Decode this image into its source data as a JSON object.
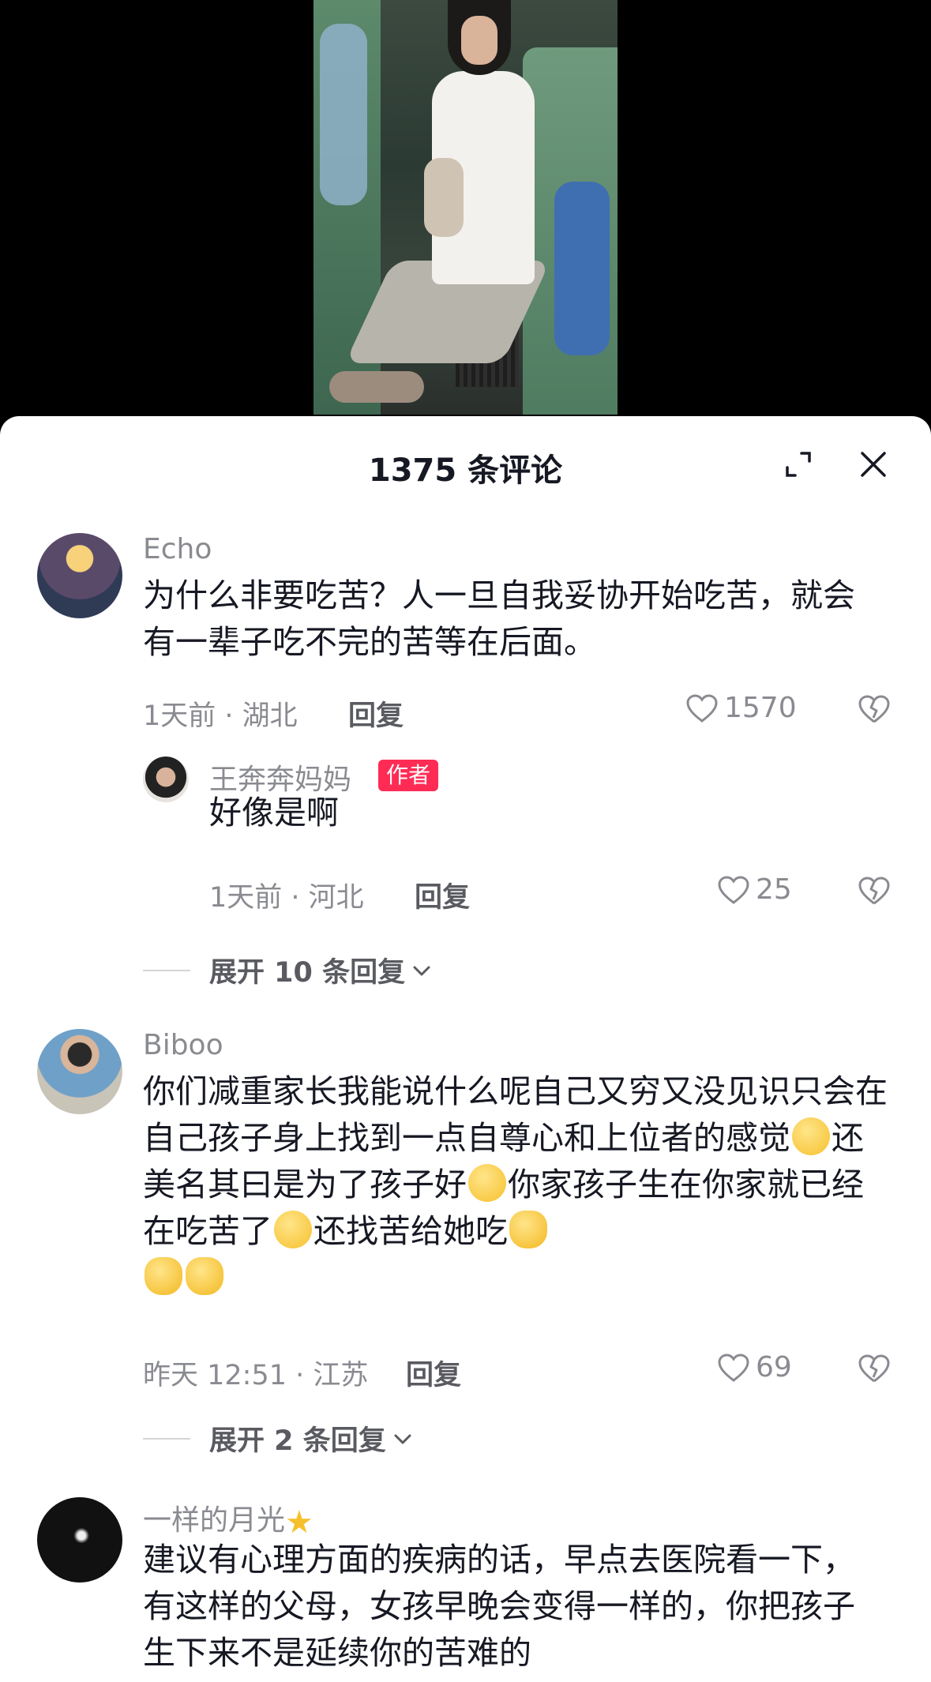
{
  "sheet": {
    "title": "1375 条评论",
    "expand_icon": "expand-icon",
    "close_icon": "close-icon"
  },
  "colors": {
    "accent": "#fe2c55",
    "text_primary": "#161823",
    "text_secondary": "#8a8b91"
  },
  "comments": [
    {
      "username": "Echo",
      "text": "为什么非要吃苦？人一旦自我妥协开始吃苦，就会有一辈子吃不完的苦等在后面。",
      "meta": "1天前 · 湖北",
      "reply_label": "回复",
      "likes": "1570"
    },
    {
      "username": "王奔奔妈妈",
      "badge": "作者",
      "text": "好像是啊",
      "meta": "1天前 · 河北",
      "reply_label": "回复",
      "likes": "25"
    },
    {
      "expand_label": "展开 10 条回复"
    },
    {
      "username": "Biboo",
      "text_parts": [
        "你们减重家长我能说什么呢自己又穷又没见识只会在自己孩子身上找到一点自尊心和上位者的感觉",
        "还美名其曰是为了孩子好",
        "你家孩子生在你家就已经在吃苦了",
        "还找苦给她吃"
      ],
      "meta": "昨天 12:51 · 江苏",
      "reply_label": "回复",
      "likes": "69"
    },
    {
      "expand_label": "展开 2 条回复"
    },
    {
      "username": "一样的月光",
      "text": "建议有心理方面的疾病的话，早点去医院看一下，有这样的父母，女孩早晚会变得一样的，你把孩子生下来不是延续你的苦难的"
    }
  ]
}
